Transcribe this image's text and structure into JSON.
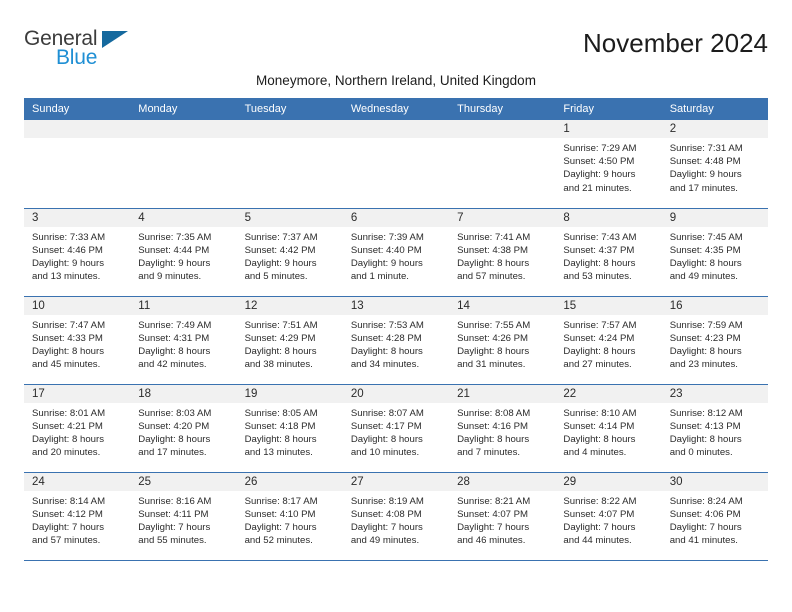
{
  "brand": {
    "name_part1": "General",
    "name_part2": "Blue",
    "triangle_icon": "triangle-icon",
    "colors": {
      "dark_text": "#3c3c3c",
      "triangle": "#15699e",
      "blue_text": "#1f8fd4"
    }
  },
  "header": {
    "title": "November 2024",
    "subtitle": "Moneymore, Northern Ireland, United Kingdom"
  },
  "theme": {
    "header_blue": "#3a72b0",
    "daynum_gray": "#f1f1f1",
    "cell_white": "#ffffff"
  },
  "weekday_headers": [
    "Sunday",
    "Monday",
    "Tuesday",
    "Wednesday",
    "Thursday",
    "Friday",
    "Saturday"
  ],
  "weeks": [
    [
      {
        "day": "",
        "empty": true,
        "sunrise": "",
        "sunset": "",
        "daylight_line1": "",
        "daylight_line2": ""
      },
      {
        "day": "",
        "empty": true,
        "sunrise": "",
        "sunset": "",
        "daylight_line1": "",
        "daylight_line2": ""
      },
      {
        "day": "",
        "empty": true,
        "sunrise": "",
        "sunset": "",
        "daylight_line1": "",
        "daylight_line2": ""
      },
      {
        "day": "",
        "empty": true,
        "sunrise": "",
        "sunset": "",
        "daylight_line1": "",
        "daylight_line2": ""
      },
      {
        "day": "",
        "empty": true,
        "sunrise": "",
        "sunset": "",
        "daylight_line1": "",
        "daylight_line2": ""
      },
      {
        "day": "1",
        "empty": false,
        "sunrise": "Sunrise: 7:29 AM",
        "sunset": "Sunset: 4:50 PM",
        "daylight_line1": "Daylight: 9 hours",
        "daylight_line2": "and 21 minutes."
      },
      {
        "day": "2",
        "empty": false,
        "sunrise": "Sunrise: 7:31 AM",
        "sunset": "Sunset: 4:48 PM",
        "daylight_line1": "Daylight: 9 hours",
        "daylight_line2": "and 17 minutes."
      }
    ],
    [
      {
        "day": "3",
        "empty": false,
        "sunrise": "Sunrise: 7:33 AM",
        "sunset": "Sunset: 4:46 PM",
        "daylight_line1": "Daylight: 9 hours",
        "daylight_line2": "and 13 minutes."
      },
      {
        "day": "4",
        "empty": false,
        "sunrise": "Sunrise: 7:35 AM",
        "sunset": "Sunset: 4:44 PM",
        "daylight_line1": "Daylight: 9 hours",
        "daylight_line2": "and 9 minutes."
      },
      {
        "day": "5",
        "empty": false,
        "sunrise": "Sunrise: 7:37 AM",
        "sunset": "Sunset: 4:42 PM",
        "daylight_line1": "Daylight: 9 hours",
        "daylight_line2": "and 5 minutes."
      },
      {
        "day": "6",
        "empty": false,
        "sunrise": "Sunrise: 7:39 AM",
        "sunset": "Sunset: 4:40 PM",
        "daylight_line1": "Daylight: 9 hours",
        "daylight_line2": "and 1 minute."
      },
      {
        "day": "7",
        "empty": false,
        "sunrise": "Sunrise: 7:41 AM",
        "sunset": "Sunset: 4:38 PM",
        "daylight_line1": "Daylight: 8 hours",
        "daylight_line2": "and 57 minutes."
      },
      {
        "day": "8",
        "empty": false,
        "sunrise": "Sunrise: 7:43 AM",
        "sunset": "Sunset: 4:37 PM",
        "daylight_line1": "Daylight: 8 hours",
        "daylight_line2": "and 53 minutes."
      },
      {
        "day": "9",
        "empty": false,
        "sunrise": "Sunrise: 7:45 AM",
        "sunset": "Sunset: 4:35 PM",
        "daylight_line1": "Daylight: 8 hours",
        "daylight_line2": "and 49 minutes."
      }
    ],
    [
      {
        "day": "10",
        "empty": false,
        "sunrise": "Sunrise: 7:47 AM",
        "sunset": "Sunset: 4:33 PM",
        "daylight_line1": "Daylight: 8 hours",
        "daylight_line2": "and 45 minutes."
      },
      {
        "day": "11",
        "empty": false,
        "sunrise": "Sunrise: 7:49 AM",
        "sunset": "Sunset: 4:31 PM",
        "daylight_line1": "Daylight: 8 hours",
        "daylight_line2": "and 42 minutes."
      },
      {
        "day": "12",
        "empty": false,
        "sunrise": "Sunrise: 7:51 AM",
        "sunset": "Sunset: 4:29 PM",
        "daylight_line1": "Daylight: 8 hours",
        "daylight_line2": "and 38 minutes."
      },
      {
        "day": "13",
        "empty": false,
        "sunrise": "Sunrise: 7:53 AM",
        "sunset": "Sunset: 4:28 PM",
        "daylight_line1": "Daylight: 8 hours",
        "daylight_line2": "and 34 minutes."
      },
      {
        "day": "14",
        "empty": false,
        "sunrise": "Sunrise: 7:55 AM",
        "sunset": "Sunset: 4:26 PM",
        "daylight_line1": "Daylight: 8 hours",
        "daylight_line2": "and 31 minutes."
      },
      {
        "day": "15",
        "empty": false,
        "sunrise": "Sunrise: 7:57 AM",
        "sunset": "Sunset: 4:24 PM",
        "daylight_line1": "Daylight: 8 hours",
        "daylight_line2": "and 27 minutes."
      },
      {
        "day": "16",
        "empty": false,
        "sunrise": "Sunrise: 7:59 AM",
        "sunset": "Sunset: 4:23 PM",
        "daylight_line1": "Daylight: 8 hours",
        "daylight_line2": "and 23 minutes."
      }
    ],
    [
      {
        "day": "17",
        "empty": false,
        "sunrise": "Sunrise: 8:01 AM",
        "sunset": "Sunset: 4:21 PM",
        "daylight_line1": "Daylight: 8 hours",
        "daylight_line2": "and 20 minutes."
      },
      {
        "day": "18",
        "empty": false,
        "sunrise": "Sunrise: 8:03 AM",
        "sunset": "Sunset: 4:20 PM",
        "daylight_line1": "Daylight: 8 hours",
        "daylight_line2": "and 17 minutes."
      },
      {
        "day": "19",
        "empty": false,
        "sunrise": "Sunrise: 8:05 AM",
        "sunset": "Sunset: 4:18 PM",
        "daylight_line1": "Daylight: 8 hours",
        "daylight_line2": "and 13 minutes."
      },
      {
        "day": "20",
        "empty": false,
        "sunrise": "Sunrise: 8:07 AM",
        "sunset": "Sunset: 4:17 PM",
        "daylight_line1": "Daylight: 8 hours",
        "daylight_line2": "and 10 minutes."
      },
      {
        "day": "21",
        "empty": false,
        "sunrise": "Sunrise: 8:08 AM",
        "sunset": "Sunset: 4:16 PM",
        "daylight_line1": "Daylight: 8 hours",
        "daylight_line2": "and 7 minutes."
      },
      {
        "day": "22",
        "empty": false,
        "sunrise": "Sunrise: 8:10 AM",
        "sunset": "Sunset: 4:14 PM",
        "daylight_line1": "Daylight: 8 hours",
        "daylight_line2": "and 4 minutes."
      },
      {
        "day": "23",
        "empty": false,
        "sunrise": "Sunrise: 8:12 AM",
        "sunset": "Sunset: 4:13 PM",
        "daylight_line1": "Daylight: 8 hours",
        "daylight_line2": "and 0 minutes."
      }
    ],
    [
      {
        "day": "24",
        "empty": false,
        "sunrise": "Sunrise: 8:14 AM",
        "sunset": "Sunset: 4:12 PM",
        "daylight_line1": "Daylight: 7 hours",
        "daylight_line2": "and 57 minutes."
      },
      {
        "day": "25",
        "empty": false,
        "sunrise": "Sunrise: 8:16 AM",
        "sunset": "Sunset: 4:11 PM",
        "daylight_line1": "Daylight: 7 hours",
        "daylight_line2": "and 55 minutes."
      },
      {
        "day": "26",
        "empty": false,
        "sunrise": "Sunrise: 8:17 AM",
        "sunset": "Sunset: 4:10 PM",
        "daylight_line1": "Daylight: 7 hours",
        "daylight_line2": "and 52 minutes."
      },
      {
        "day": "27",
        "empty": false,
        "sunrise": "Sunrise: 8:19 AM",
        "sunset": "Sunset: 4:08 PM",
        "daylight_line1": "Daylight: 7 hours",
        "daylight_line2": "and 49 minutes."
      },
      {
        "day": "28",
        "empty": false,
        "sunrise": "Sunrise: 8:21 AM",
        "sunset": "Sunset: 4:07 PM",
        "daylight_line1": "Daylight: 7 hours",
        "daylight_line2": "and 46 minutes."
      },
      {
        "day": "29",
        "empty": false,
        "sunrise": "Sunrise: 8:22 AM",
        "sunset": "Sunset: 4:07 PM",
        "daylight_line1": "Daylight: 7 hours",
        "daylight_line2": "and 44 minutes."
      },
      {
        "day": "30",
        "empty": false,
        "sunrise": "Sunrise: 8:24 AM",
        "sunset": "Sunset: 4:06 PM",
        "daylight_line1": "Daylight: 7 hours",
        "daylight_line2": "and 41 minutes."
      }
    ]
  ]
}
